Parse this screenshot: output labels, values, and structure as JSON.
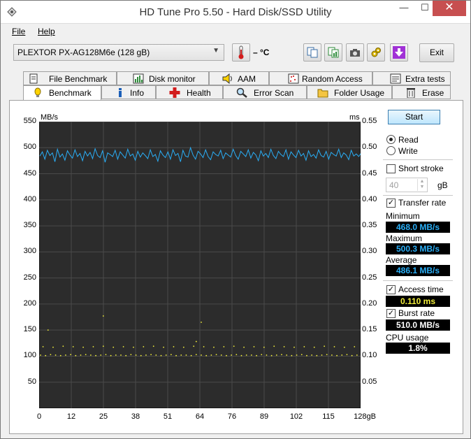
{
  "window": {
    "title": "HD Tune Pro 5.50 - Hard Disk/SSD Utility",
    "close_glyph": "✕",
    "min_glyph": "—",
    "max_glyph": "☐"
  },
  "menu": {
    "file": "File",
    "help": "Help"
  },
  "toolbar": {
    "drive": "PLEXTOR PX-AG128M6e (128 gB)",
    "temperature": "– °C",
    "exit_label": "Exit"
  },
  "tabs_top": [
    {
      "label": "File Benchmark",
      "icon": "file-benchmark-icon"
    },
    {
      "label": "Disk monitor",
      "icon": "disk-monitor-icon"
    },
    {
      "label": "AAM",
      "icon": "speaker-icon"
    },
    {
      "label": "Random Access",
      "icon": "random-access-icon"
    },
    {
      "label": "Extra tests",
      "icon": "extra-tests-icon"
    }
  ],
  "tabs_bottom": [
    {
      "label": "Benchmark",
      "icon": "benchmark-icon",
      "active": true
    },
    {
      "label": "Info",
      "icon": "info-icon"
    },
    {
      "label": "Health",
      "icon": "health-icon"
    },
    {
      "label": "Error Scan",
      "icon": "magnifier-icon"
    },
    {
      "label": "Folder Usage",
      "icon": "folder-icon"
    },
    {
      "label": "Erase",
      "icon": "trash-icon"
    }
  ],
  "controls": {
    "start_label": "Start",
    "read_label": "Read",
    "write_label": "Write",
    "mode": "Read",
    "short_stroke_label": "Short stroke",
    "short_stroke_checked": false,
    "short_stroke_value": "40",
    "short_stroke_unit": "gB",
    "transfer_rate_label": "Transfer rate",
    "transfer_rate_checked": true,
    "minimum_label": "Minimum",
    "minimum_value": "468.0 MB/s",
    "maximum_label": "Maximum",
    "maximum_value": "500.3 MB/s",
    "average_label": "Average",
    "average_value": "486.1 MB/s",
    "access_time_label": "Access time",
    "access_time_checked": true,
    "access_time_value": "0.110 ms",
    "burst_rate_label": "Burst rate",
    "burst_rate_checked": true,
    "burst_rate_value": "510.0 MB/s",
    "cpu_usage_label": "CPU usage",
    "cpu_usage_value": "1.8%"
  },
  "chart_data": {
    "type": "line",
    "left_axis_label": "MB/s",
    "right_axis_label": "ms",
    "ylim_left": [
      0,
      550
    ],
    "ylim_right": [
      0,
      0.55
    ],
    "yticks_left": [
      "550",
      "500",
      "450",
      "400",
      "350",
      "300",
      "250",
      "200",
      "150",
      "100",
      "50"
    ],
    "yticks_right": [
      "0.55",
      "0.50",
      "0.45",
      "0.40",
      "0.35",
      "0.30",
      "0.25",
      "0.20",
      "0.15",
      "0.10",
      "0.05"
    ],
    "xlim": [
      0,
      128
    ],
    "xticks": [
      "0",
      "12",
      "25",
      "38",
      "51",
      "64",
      "76",
      "89",
      "102",
      "115",
      "128gB"
    ],
    "series": [
      {
        "name": "Transfer rate",
        "color": "#2aaef6",
        "x": [
          0,
          1,
          2,
          3,
          4,
          5,
          6,
          7,
          8,
          9,
          10,
          11,
          12,
          13,
          14,
          15,
          16,
          17,
          18,
          19,
          20,
          21,
          22,
          23,
          24,
          25,
          26,
          27,
          28,
          29,
          30,
          31,
          32,
          33,
          34,
          35,
          36,
          37,
          38,
          39,
          40,
          41,
          42,
          43,
          44,
          45,
          46,
          47,
          48,
          49,
          50,
          51,
          52,
          53,
          54,
          55,
          56,
          57,
          58,
          59,
          60,
          61,
          62,
          63,
          64,
          65,
          66,
          67,
          68,
          69,
          70,
          71,
          72,
          73,
          74,
          75,
          76,
          77,
          78,
          79,
          80,
          81,
          82,
          83,
          84,
          85,
          86,
          87,
          88,
          89,
          90,
          91,
          92,
          93,
          94,
          95,
          96,
          97,
          98,
          99,
          100,
          101,
          102,
          103,
          104,
          105,
          106,
          107,
          108,
          109,
          110,
          111,
          112,
          113,
          114,
          115,
          116,
          117,
          118,
          119,
          120,
          121,
          122,
          123,
          124,
          125,
          126,
          127,
          128
        ],
        "y": [
          484,
          492,
          478,
          495,
          485,
          490,
          473,
          497,
          482,
          488,
          476,
          494,
          486,
          480,
          496,
          483,
          489,
          475,
          493,
          484,
          491,
          479,
          498,
          485,
          481,
          494,
          472,
          490,
          487,
          483,
          495,
          478,
          492,
          486,
          480,
          497,
          484,
          488,
          476,
          493,
          482,
          490,
          485,
          479,
          496,
          483,
          487,
          474,
          494,
          486,
          481,
          492,
          478,
          496,
          485,
          489,
          473,
          495,
          484,
          482,
          500,
          486,
          478,
          493,
          488,
          481,
          496,
          483,
          477,
          492,
          487,
          484,
          495,
          479,
          490,
          486,
          482,
          497,
          485,
          478,
          493,
          488,
          483,
          496,
          480,
          491,
          486,
          475,
          494,
          484,
          489,
          481,
          497,
          485,
          479,
          493,
          487,
          483,
          496,
          478,
          492,
          486,
          481,
          495,
          484,
          489,
          476,
          494,
          483,
          487,
          480,
          496,
          485,
          482,
          493,
          478,
          491,
          487,
          484,
          497,
          481,
          490,
          486,
          477,
          495,
          484,
          488,
          483,
          490
        ]
      },
      {
        "name": "Access time",
        "color": "#f2ee3a",
        "x": [
          0,
          2,
          4,
          6,
          8,
          10,
          12,
          14,
          16,
          18,
          20,
          22,
          24,
          26,
          28,
          30,
          32,
          34,
          36,
          38,
          40,
          42,
          44,
          46,
          48,
          50,
          52,
          54,
          56,
          58,
          60,
          62,
          64,
          66,
          68,
          70,
          72,
          74,
          76,
          78,
          80,
          82,
          84,
          86,
          88,
          90,
          92,
          94,
          96,
          98,
          100,
          102,
          104,
          106,
          108,
          110,
          112,
          114,
          116,
          118,
          120,
          122,
          124,
          126,
          1,
          5,
          9,
          13,
          17,
          21,
          25,
          29,
          33,
          37,
          41,
          45,
          49,
          53,
          57,
          61,
          65,
          69,
          73,
          77,
          81,
          85,
          89,
          93,
          97,
          101,
          105,
          109,
          113,
          117,
          121,
          125,
          3,
          25,
          64,
          62
        ],
        "y": [
          0.102,
          0.101,
          0.103,
          0.102,
          0.101,
          0.102,
          0.103,
          0.101,
          0.102,
          0.103,
          0.102,
          0.101,
          0.102,
          0.103,
          0.101,
          0.102,
          0.102,
          0.101,
          0.103,
          0.102,
          0.101,
          0.102,
          0.103,
          0.102,
          0.101,
          0.102,
          0.103,
          0.101,
          0.102,
          0.102,
          0.101,
          0.103,
          0.102,
          0.101,
          0.102,
          0.103,
          0.102,
          0.101,
          0.102,
          0.103,
          0.101,
          0.102,
          0.102,
          0.101,
          0.103,
          0.102,
          0.101,
          0.102,
          0.103,
          0.102,
          0.101,
          0.102,
          0.103,
          0.101,
          0.102,
          0.101,
          0.102,
          0.103,
          0.102,
          0.101,
          0.102,
          0.103,
          0.101,
          0.102,
          0.118,
          0.117,
          0.119,
          0.118,
          0.117,
          0.118,
          0.119,
          0.117,
          0.118,
          0.117,
          0.118,
          0.119,
          0.117,
          0.118,
          0.117,
          0.119,
          0.118,
          0.117,
          0.118,
          0.119,
          0.117,
          0.118,
          0.117,
          0.119,
          0.118,
          0.117,
          0.118,
          0.117,
          0.119,
          0.118,
          0.117,
          0.118,
          0.15,
          0.177,
          0.165,
          0.128
        ]
      }
    ],
    "grid": true
  }
}
